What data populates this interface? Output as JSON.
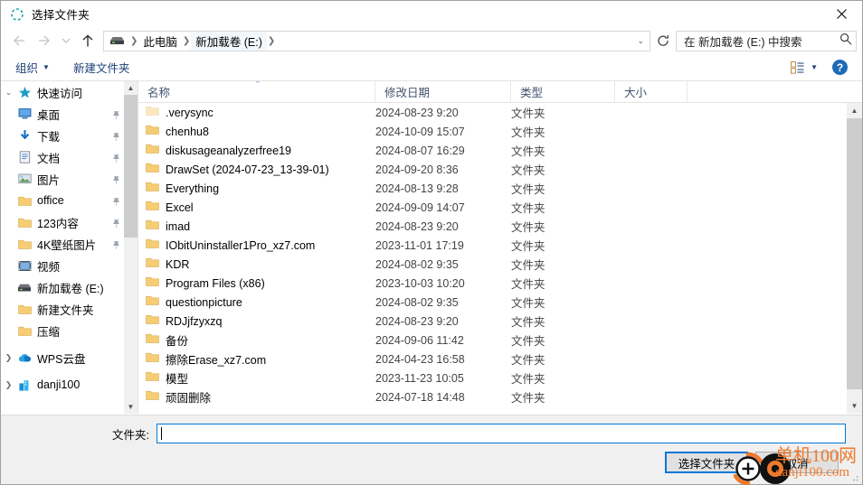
{
  "window": {
    "title": "选择文件夹",
    "title_icon": "loading-spinner-icon",
    "close_label": "✕"
  },
  "nav": {
    "back_icon": "arrow-left-icon",
    "forward_icon": "arrow-right-icon",
    "recent_icon": "chevron-down-icon",
    "up_icon": "arrow-up-icon",
    "refresh_icon": "refresh-icon",
    "drive_icon": "drive-icon",
    "breadcrumbs": [
      "此电脑",
      "新加载卷 (E:)"
    ],
    "separator": "❯"
  },
  "search": {
    "placeholder": "在 新加载卷 (E:) 中搜索",
    "icon": "search-icon"
  },
  "toolbar": {
    "organize_label": "组织",
    "new_folder_label": "新建文件夹",
    "view_icon": "view-mode-icon",
    "view_caret": "▼",
    "help_label": "?"
  },
  "sidebar": {
    "items": [
      {
        "label": "快速访问",
        "icon": "star-icon",
        "chevron": "⌄",
        "indent": false,
        "pinned": false
      },
      {
        "label": "桌面",
        "icon": "desktop-icon",
        "chevron": "",
        "indent": true,
        "pinned": true
      },
      {
        "label": "下载",
        "icon": "download-icon",
        "chevron": "",
        "indent": true,
        "pinned": true
      },
      {
        "label": "文档",
        "icon": "document-icon",
        "chevron": "",
        "indent": true,
        "pinned": true
      },
      {
        "label": "图片",
        "icon": "pictures-icon",
        "chevron": "",
        "indent": true,
        "pinned": true
      },
      {
        "label": "office",
        "icon": "folder-icon",
        "chevron": "",
        "indent": true,
        "pinned": true
      },
      {
        "label": "123内容",
        "icon": "folder-icon",
        "chevron": "",
        "indent": true,
        "pinned": true
      },
      {
        "label": "4K壁纸图片",
        "icon": "folder-icon",
        "chevron": "",
        "indent": true,
        "pinned": true
      },
      {
        "label": "视频",
        "icon": "video-icon",
        "chevron": "",
        "indent": true,
        "pinned": false
      },
      {
        "label": "新加载卷 (E:)",
        "icon": "drive-icon",
        "chevron": "",
        "indent": true,
        "pinned": false
      },
      {
        "label": "新建文件夹",
        "icon": "folder-icon",
        "chevron": "",
        "indent": true,
        "pinned": false
      },
      {
        "label": "压缩",
        "icon": "folder-icon",
        "chevron": "",
        "indent": true,
        "pinned": false
      },
      {
        "label": "WPS云盘",
        "icon": "cloud-icon",
        "chevron": "❯",
        "indent": false,
        "pinned": false
      },
      {
        "label": "danji100",
        "icon": "building-icon",
        "chevron": "❯",
        "indent": false,
        "pinned": false
      }
    ]
  },
  "list": {
    "columns": [
      "名称",
      "修改日期",
      "类型",
      "大小"
    ],
    "sort_indicator": "⌃",
    "rows": [
      {
        "name": ".verysync",
        "date": "2024-08-23 9:20",
        "type": "文件夹",
        "size": "",
        "hidden": true
      },
      {
        "name": "chenhu8",
        "date": "2024-10-09 15:07",
        "type": "文件夹",
        "size": "",
        "hidden": false
      },
      {
        "name": "diskusageanalyzerfree19",
        "date": "2024-08-07 16:29",
        "type": "文件夹",
        "size": "",
        "hidden": false
      },
      {
        "name": "DrawSet (2024-07-23_13-39-01)",
        "date": "2024-09-20 8:36",
        "type": "文件夹",
        "size": "",
        "hidden": false
      },
      {
        "name": "Everything",
        "date": "2024-08-13 9:28",
        "type": "文件夹",
        "size": "",
        "hidden": false
      },
      {
        "name": "Excel",
        "date": "2024-09-09 14:07",
        "type": "文件夹",
        "size": "",
        "hidden": false
      },
      {
        "name": "imad",
        "date": "2024-08-23 9:20",
        "type": "文件夹",
        "size": "",
        "hidden": false
      },
      {
        "name": "IObitUninstaller1Pro_xz7.com",
        "date": "2023-11-01 17:19",
        "type": "文件夹",
        "size": "",
        "hidden": false
      },
      {
        "name": "KDR",
        "date": "2024-08-02 9:35",
        "type": "文件夹",
        "size": "",
        "hidden": false
      },
      {
        "name": "Program Files (x86)",
        "date": "2023-10-03 10:20",
        "type": "文件夹",
        "size": "",
        "hidden": false
      },
      {
        "name": "questionpicture",
        "date": "2024-08-02 9:35",
        "type": "文件夹",
        "size": "",
        "hidden": false
      },
      {
        "name": "RDJjfzyxzq",
        "date": "2024-08-23 9:20",
        "type": "文件夹",
        "size": "",
        "hidden": false
      },
      {
        "name": "备份",
        "date": "2024-09-06 11:42",
        "type": "文件夹",
        "size": "",
        "hidden": false
      },
      {
        "name": "擦除Erase_xz7.com",
        "date": "2024-04-23 16:58",
        "type": "文件夹",
        "size": "",
        "hidden": false
      },
      {
        "name": "模型",
        "date": "2023-11-23 10:05",
        "type": "文件夹",
        "size": "",
        "hidden": false
      },
      {
        "name": "顽固删除",
        "date": "2024-07-18 14:48",
        "type": "文件夹",
        "size": "",
        "hidden": false
      }
    ]
  },
  "footer": {
    "folder_label": "文件夹:",
    "folder_value": "",
    "select_button": "选择文件夹",
    "cancel_button": "取消"
  },
  "watermark": {
    "line1": "单机100网",
    "line2": "danji100.com",
    "color": "#f0792b"
  },
  "colors": {
    "accent": "#0078d7",
    "folder": "#f7cd73",
    "toolbar_text": "#1c3f75",
    "header_text": "#41546e"
  }
}
